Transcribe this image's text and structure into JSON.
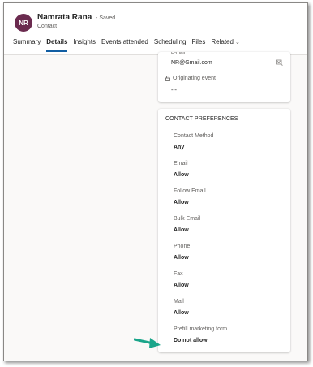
{
  "header": {
    "avatar_initials": "NR",
    "name": "Namrata Rana",
    "status": "- Saved",
    "entity": "Contact"
  },
  "tabs": [
    {
      "label": "Summary",
      "active": false
    },
    {
      "label": "Details",
      "active": true
    },
    {
      "label": "Insights",
      "active": false
    },
    {
      "label": "Events attended",
      "active": false
    },
    {
      "label": "Scheduling",
      "active": false
    },
    {
      "label": "Files",
      "active": false
    },
    {
      "label": "Related",
      "active": false
    }
  ],
  "contact_card": {
    "email_value": "NR@Gmail.com",
    "originating_event_label": "Originating event",
    "originating_event_value": "---"
  },
  "preferences": {
    "title": "CONTACT PREFERENCES",
    "fields": [
      {
        "label": "Contact Method",
        "value": "Any"
      },
      {
        "label": "Email",
        "value": "Allow"
      },
      {
        "label": "Follow Email",
        "value": "Allow"
      },
      {
        "label": "Bulk Email",
        "value": "Allow"
      },
      {
        "label": "Phone",
        "value": "Allow"
      },
      {
        "label": "Fax",
        "value": "Allow"
      },
      {
        "label": "Mail",
        "value": "Allow"
      },
      {
        "label": "Prefill marketing form",
        "value": "Do not allow"
      }
    ]
  },
  "colors": {
    "avatar": "#6b2b4f",
    "active_tab_underline": "#115ea3",
    "arrow": "#1aa58a"
  }
}
